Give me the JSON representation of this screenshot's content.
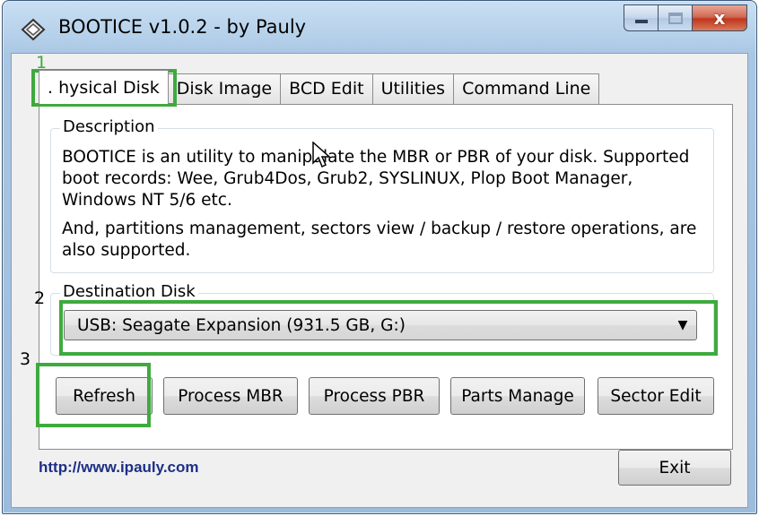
{
  "window": {
    "title": "BOOTICE v1.0.2 - by Pauly",
    "icon": "bootice-app-icon",
    "caption_buttons": [
      "minimize-icon",
      "maximize-icon",
      "close-icon"
    ]
  },
  "tabs": [
    {
      "label": ". hysical Disk",
      "active": true
    },
    {
      "label": "Disk Image",
      "active": false
    },
    {
      "label": "BCD Edit",
      "active": false
    },
    {
      "label": "Utilities",
      "active": false
    },
    {
      "label": "Command Line",
      "active": false
    }
  ],
  "description": {
    "legend": "Description",
    "paragraph1": "BOOTICE is an utility to manipulate the MBR or PBR of your disk. Supported boot records: Wee, Grub4Dos, Grub2, SYSLINUX, Plop Boot Manager, Windows NT 5/6 etc.",
    "paragraph2": "And, partitions management, sectors view / backup / restore operations, are also supported."
  },
  "destination": {
    "legend": "Destination Disk",
    "selected": "USB: Seagate Expansion (931.5 GB, G:)"
  },
  "buttons": {
    "refresh": "Refresh",
    "process_mbr": "Process MBR",
    "process_pbr": "Process PBR",
    "parts_manage": "Parts Manage",
    "sector_edit": "Sector Edit",
    "exit": "Exit"
  },
  "footer": {
    "link": "http://www.ipauly.com"
  },
  "annotations": {
    "n1": "1",
    "n2": "2",
    "n3": "3",
    "color": "#3eaa3e"
  }
}
